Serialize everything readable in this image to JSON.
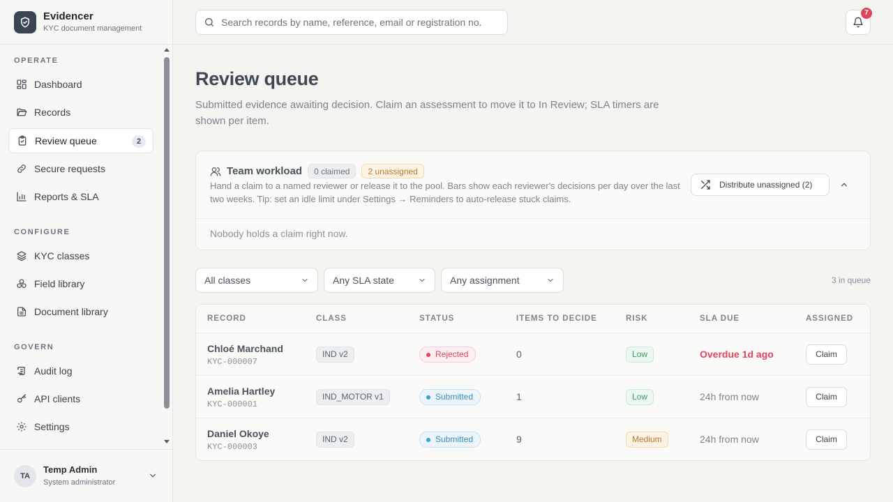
{
  "app": {
    "name": "Evidencer",
    "subtitle": "KYC document management"
  },
  "sidebar": {
    "sections": {
      "operate": "OPERATE",
      "configure": "CONFIGURE",
      "govern": "GOVERN"
    },
    "items": {
      "dashboard": "Dashboard",
      "records": "Records",
      "review_queue": "Review queue",
      "review_queue_badge": "2",
      "secure_requests": "Secure requests",
      "reports": "Reports & SLA",
      "kyc_classes": "KYC classes",
      "field_library": "Field library",
      "document_library": "Document library",
      "audit_log": "Audit log",
      "api_clients": "API clients",
      "settings": "Settings"
    },
    "active": "review_queue"
  },
  "user": {
    "initials": "TA",
    "name": "Temp Admin",
    "role": "System administrator"
  },
  "topbar": {
    "search_placeholder": "Search records by name, reference, email or registration no.",
    "notification_count": "7"
  },
  "page": {
    "title": "Review queue",
    "description": "Submitted evidence awaiting decision. Claim an assessment to move it to In Review; SLA timers are shown per item."
  },
  "workload": {
    "title": "Team workload",
    "claimed": "0 claimed",
    "unassigned": "2 unassigned",
    "description": "Hand a claim to a named reviewer or release it to the pool. Bars show each reviewer's decisions per day over the last two weeks. Tip: set an idle limit under Settings → Reminders to auto-release stuck claims.",
    "distribute_label": "Distribute unassigned (2)",
    "empty": "Nobody holds a claim right now."
  },
  "filters": {
    "class": "All classes",
    "sla": "Any SLA state",
    "assignment": "Any assignment",
    "count": "3 in queue"
  },
  "table": {
    "columns": [
      "RECORD",
      "CLASS",
      "STATUS",
      "ITEMS TO DECIDE",
      "RISK",
      "SLA DUE",
      "ASSIGNED"
    ],
    "rows": [
      {
        "name": "Chloé Marchand",
        "ref": "KYC-000007",
        "class": "IND v2",
        "status": "Rejected",
        "items": "0",
        "risk": "Low",
        "sla": "Overdue 1d ago",
        "action": "Claim"
      },
      {
        "name": "Amelia Hartley",
        "ref": "KYC-000001",
        "class": "IND_MOTOR v1",
        "status": "Submitted",
        "items": "1",
        "risk": "Low",
        "sla": "24h from now",
        "action": "Claim"
      },
      {
        "name": "Daniel Okoye",
        "ref": "KYC-000003",
        "class": "IND v2",
        "status": "Submitted",
        "items": "9",
        "risk": "Medium",
        "sla": "24h from now",
        "action": "Claim"
      }
    ]
  },
  "colors": {
    "brand": "#3b4652",
    "danger": "#e0445e",
    "info": "#3a9fd6",
    "success": "#3b9a62",
    "warning": "#b8782d"
  }
}
